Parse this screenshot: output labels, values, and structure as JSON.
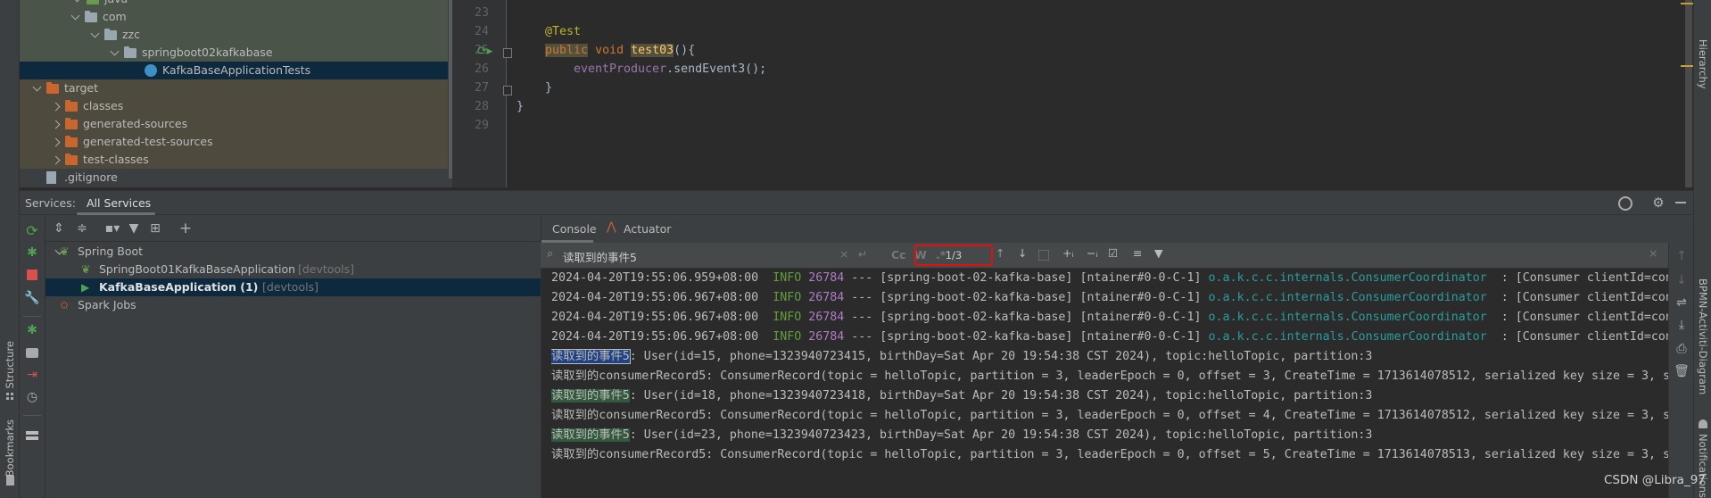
{
  "project_tree": {
    "items": [
      {
        "label": "java",
        "kind": "src"
      },
      {
        "label": "com",
        "kind": "package"
      },
      {
        "label": "zzc",
        "kind": "package"
      },
      {
        "label": "springboot02kafkabase",
        "kind": "package"
      },
      {
        "label": "KafkaBaseApplicationTests",
        "kind": "class",
        "selected": true
      },
      {
        "label": "target",
        "kind": "excluded"
      },
      {
        "label": "classes",
        "kind": "excluded"
      },
      {
        "label": "generated-sources",
        "kind": "excluded"
      },
      {
        "label": "generated-test-sources",
        "kind": "excluded"
      },
      {
        "label": "test-classes",
        "kind": "excluded"
      },
      {
        "label": ".gitignore",
        "kind": "file"
      }
    ]
  },
  "editor": {
    "line_numbers": [
      "23",
      "24",
      "25",
      "26",
      "27",
      "28",
      "29"
    ],
    "lines": {
      "annotation": "@Test",
      "kw_public": "public",
      "kw_void": "void",
      "method_name": "test03",
      "method_tail": "(){",
      "field": "eventProducer",
      "call": ".sendEvent3();",
      "close_inner": "}",
      "close_outer": "}"
    }
  },
  "services": {
    "label": "Services:",
    "tab": "All Services",
    "tree": [
      {
        "label": "Spring Boot"
      },
      {
        "label": "SpringBoot01KafkaBaseApplication",
        "suffix": "[devtools]"
      },
      {
        "label": "KafkaBaseApplication (1)",
        "suffix": "[devtools]",
        "selected": true
      },
      {
        "label": "Spark Jobs"
      }
    ]
  },
  "console": {
    "tabs": [
      "Console",
      "Actuator"
    ],
    "search_value": "读取到的事件5",
    "match_counter": "1/3",
    "toggles": [
      "Cc",
      "W",
      ".*"
    ],
    "log_lines": [
      {
        "ts": "2024-04-20T19:55:06.959+08:00",
        "level": "INFO",
        "pid": "26784",
        "mid": " --- [spring-boot-02-kafka-base] [ntainer#0-0-C-1] ",
        "logger": "o.a.k.c.c.internals.ConsumerCoordinator",
        "msg": "  : [Consumer clientId=con"
      },
      {
        "ts": "2024-04-20T19:55:06.967+08:00",
        "level": "INFO",
        "pid": "26784",
        "mid": " --- [spring-boot-02-kafka-base] [ntainer#0-0-C-1] ",
        "logger": "o.a.k.c.c.internals.ConsumerCoordinator",
        "msg": "  : [Consumer clientId=con"
      },
      {
        "ts": "2024-04-20T19:55:06.967+08:00",
        "level": "INFO",
        "pid": "26784",
        "mid": " --- [spring-boot-02-kafka-base] [ntainer#0-0-C-1] ",
        "logger": "o.a.k.c.c.internals.ConsumerCoordinator",
        "msg": "  : [Consumer clientId=con"
      },
      {
        "ts": "2024-04-20T19:55:06.967+08:00",
        "level": "INFO",
        "pid": "26784",
        "mid": " --- [spring-boot-02-kafka-base] [ntainer#0-0-C-1] ",
        "logger": "o.a.k.c.c.internals.ConsumerCoordinator",
        "msg": "  : [Consumer clientId=con"
      }
    ],
    "out_lines": [
      {
        "hl": "读取到的事件5",
        "hl_type": "current",
        "rest": ": User(id=15, phone=1323940723415, birthDay=Sat Apr 20 19:54:38 CST 2024), topic:helloTopic, partition:3"
      },
      {
        "hl": "",
        "hl_type": "none",
        "rest": "读取到的consumerRecord5: ConsumerRecord(topic = helloTopic, partition = 3, leaderEpoch = 0, offset = 3, CreateTime = 1713614078512, serialized key size = 3, s"
      },
      {
        "hl": "读取到的事件5",
        "hl_type": "match",
        "rest": ": User(id=18, phone=1323940723418, birthDay=Sat Apr 20 19:54:38 CST 2024), topic:helloTopic, partition:3"
      },
      {
        "hl": "",
        "hl_type": "none",
        "rest": "读取到的consumerRecord5: ConsumerRecord(topic = helloTopic, partition = 3, leaderEpoch = 0, offset = 4, CreateTime = 1713614078512, serialized key size = 3, s"
      },
      {
        "hl": "读取到的事件5",
        "hl_type": "match",
        "rest": ": User(id=23, phone=1323940723423, birthDay=Sat Apr 20 19:54:38 CST 2024), topic:helloTopic, partition:3"
      },
      {
        "hl": "",
        "hl_type": "none",
        "rest": "读取到的consumerRecord5: ConsumerRecord(topic = helloTopic, partition = 3, leaderEpoch = 0, offset = 5, CreateTime = 1713614078513, serialized key size = 3, s"
      }
    ]
  },
  "side_labels": {
    "structure": "Structure",
    "bookmarks": "Bookmarks",
    "hierarchy": "Hierarchy",
    "bpmn": "BPMN-Activiti-Diagram",
    "notifications": "Notifications"
  },
  "watermark": "CSDN @Libra_97",
  "colors": {
    "info": "#5f9e3a",
    "pid": "#b07cc6",
    "logger": "#2a9d9d",
    "keyword": "#cc7832",
    "annotation": "#bbb529",
    "method": "#ffc66d",
    "field": "#9876aa",
    "selection": "#0d293e",
    "find_box_border": "#e01010"
  }
}
